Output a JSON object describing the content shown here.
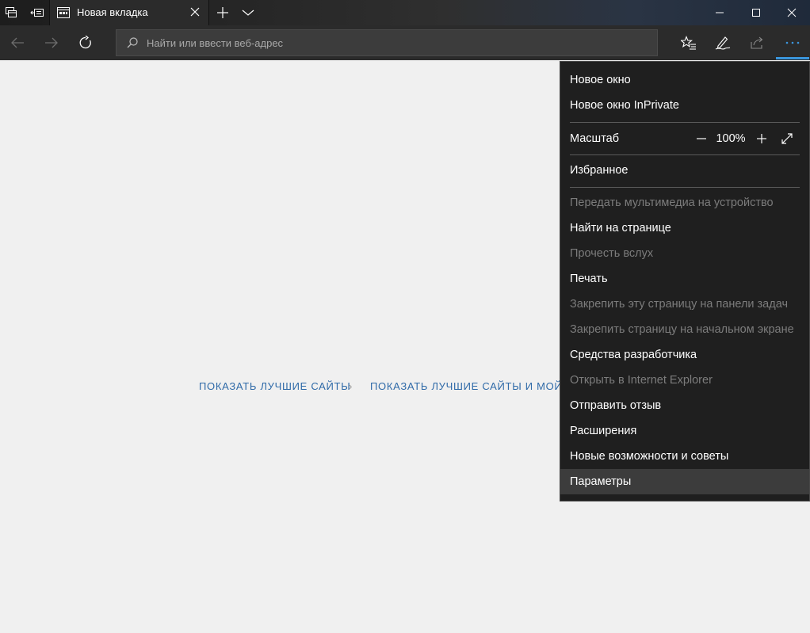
{
  "tab": {
    "title": "Новая вкладка"
  },
  "address_bar": {
    "placeholder": "Найти или ввести веб-адрес"
  },
  "content": {
    "link_top_sites": "ПОКАЗАТЬ ЛУЧШИЕ САЙТЫ",
    "link_top_sites_and_feed": "ПОКАЗАТЬ ЛУЧШИЕ САЙТЫ И МОЙ"
  },
  "menu": {
    "new_window": "Новое окно",
    "new_inprivate_window": "Новое окно InPrivate",
    "zoom_label": "Масштаб",
    "zoom_value": "100%",
    "favorites": "Избранное",
    "cast_media": "Передать мультимедиа на устройство",
    "find_on_page": "Найти на странице",
    "read_aloud": "Прочесть вслух",
    "print": "Печать",
    "pin_to_taskbar": "Закрепить эту страницу на панели задач",
    "pin_to_start": "Закрепить страницу на начальном экране",
    "developer_tools": "Средства разработчика",
    "open_in_ie": "Открыть в Internet Explorer",
    "send_feedback": "Отправить отзыв",
    "extensions": "Расширения",
    "whats_new": "Новые возможности и советы",
    "settings": "Параметры"
  },
  "colors": {
    "accent": "#3a96dd",
    "link": "#2f6aa8",
    "menu_background": "#1f1f1f",
    "disabled_text": "#7c7c7c"
  },
  "icons": [
    "tab-set-aside-icon",
    "tabs-preview-icon",
    "page-icon",
    "close-icon",
    "plus-icon",
    "chevron-down-icon",
    "minimize-icon",
    "maximize-icon",
    "back-arrow-icon",
    "forward-arrow-icon",
    "refresh-icon",
    "search-icon",
    "favorites-star-icon",
    "pen-icon",
    "share-icon",
    "more-dots-icon",
    "fullscreen-icon"
  ]
}
